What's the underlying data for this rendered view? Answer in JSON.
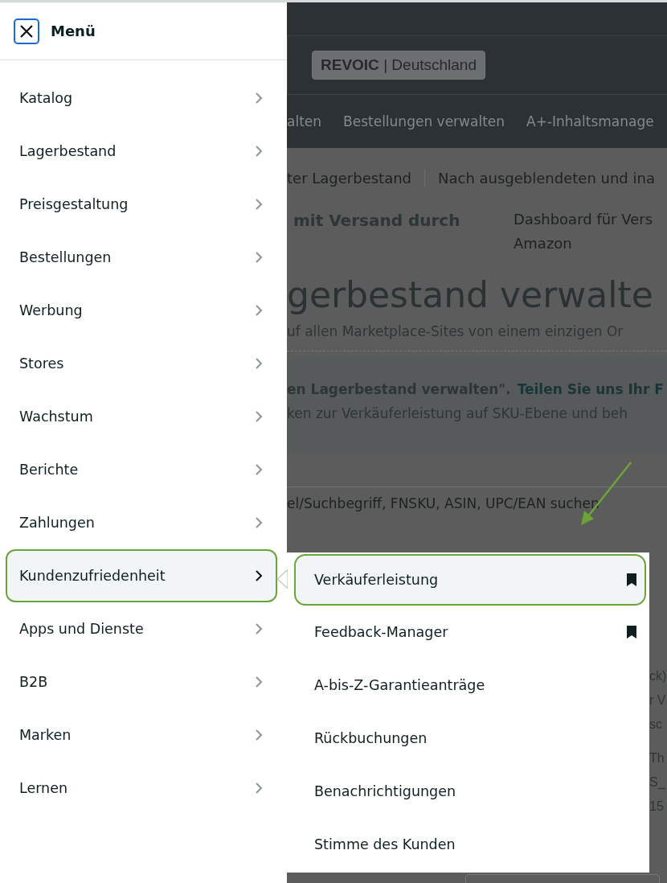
{
  "menu": {
    "title": "Menü",
    "items": [
      {
        "label": "Katalog",
        "selected": false
      },
      {
        "label": "Lagerbestand",
        "selected": false
      },
      {
        "label": "Preisgestaltung",
        "selected": false
      },
      {
        "label": "Bestellungen",
        "selected": false
      },
      {
        "label": "Werbung",
        "selected": false
      },
      {
        "label": "Stores",
        "selected": false
      },
      {
        "label": "Wachstum",
        "selected": false
      },
      {
        "label": "Berichte",
        "selected": false
      },
      {
        "label": "Zahlungen",
        "selected": false
      },
      {
        "label": "Kundenzufriedenheit",
        "selected": true
      },
      {
        "label": "Apps und Dienste",
        "selected": false
      },
      {
        "label": "B2B",
        "selected": false
      },
      {
        "label": "Marken",
        "selected": false
      },
      {
        "label": "Lernen",
        "selected": false
      }
    ]
  },
  "submenu": {
    "items": [
      {
        "label": "Verkäuferleistung",
        "selected": true,
        "bookmarked": true
      },
      {
        "label": "Feedback-Manager",
        "selected": false,
        "bookmarked": true
      },
      {
        "label": "A-bis-Z-Garantieanträge",
        "selected": false,
        "bookmarked": false
      },
      {
        "label": "Rückbuchungen",
        "selected": false,
        "bookmarked": false
      },
      {
        "label": "Benachrichtigungen",
        "selected": false,
        "bookmarked": false
      },
      {
        "label": "Stimme des Kunden",
        "selected": false,
        "bookmarked": false
      }
    ]
  },
  "background_page": {
    "account_badge": {
      "brand": "REVOIC",
      "separator": "|",
      "region": "Deutschland"
    },
    "nav": [
      "alten",
      "Bestellungen verwalten",
      "A+-Inhaltsmanage"
    ],
    "subnav": [
      "ter Lagerbestand",
      "Nach ausgeblendeten und ina"
    ],
    "section_title": "mit Versand durch",
    "dashboard_link": [
      "Dashboard für Vers",
      "Amazon"
    ],
    "heading": "gerbestand verwalte",
    "subtitle": "uf allen Marketplace-Sites von einem einzigen Or",
    "notice": {
      "bold": "en Lagerbestand verwalten\".",
      "link": "Teilen Sie uns Ihr F",
      "line_2": "ken zur Verkäuferleistung auf SKU-Ebene und beh"
    },
    "search_placeholder": "el/Suchbegriff, FNSKU, ASIN, UPC/EAN suchen",
    "edge_fragments": [
      "ck)",
      "r V",
      "sc",
      "Th",
      "S_",
      "15"
    ]
  }
}
